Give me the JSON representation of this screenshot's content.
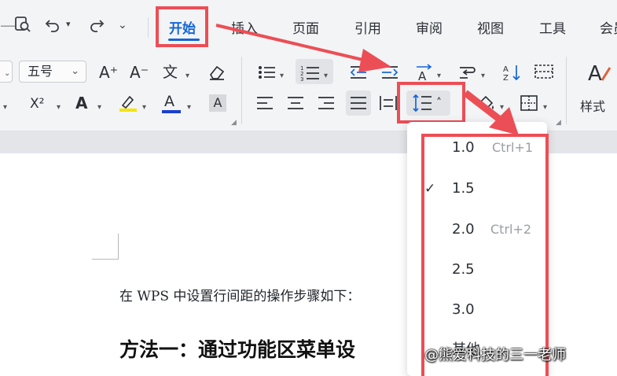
{
  "quick_access": {
    "find_icon": "document-search-icon",
    "undo_icon": "undo-icon",
    "redo_icon": "redo-icon",
    "more_icon": "chevron-down-icon"
  },
  "tabs": [
    {
      "label": "开始",
      "active": true
    },
    {
      "label": "插入"
    },
    {
      "label": "页面"
    },
    {
      "label": "引用"
    },
    {
      "label": "审阅"
    },
    {
      "label": "视图"
    },
    {
      "label": "工具"
    },
    {
      "label": "会员"
    }
  ],
  "ribbon": {
    "font_size_value": "五号",
    "grow_font_label": "A⁺",
    "shrink_font_label": "A⁻",
    "phonetic_label": "文",
    "superscript_label": "X²",
    "text_effect_label": "A",
    "font_color_label": "A",
    "char_shading_label": "A",
    "styles_label": "样式",
    "icons": [
      "bullets-icon",
      "numbering-icon",
      "decrease-indent-icon",
      "increase-indent-icon",
      "text-direction-icon",
      "sort-icon",
      "table-icon",
      "styles-icon",
      "align-left-icon",
      "align-center-icon",
      "align-right-icon",
      "justify-icon",
      "distributed-icon",
      "line-spacing-icon",
      "shading-icon",
      "border-icon",
      "eraser-icon",
      "highlight-icon"
    ]
  },
  "document": {
    "line1": "在 WPS 中设置行间距的操作步骤如下：",
    "heading": "方法一：通过功能区菜单设"
  },
  "line_spacing_menu": {
    "options": [
      {
        "value": "1.0",
        "shortcut": "Ctrl+1",
        "checked": false
      },
      {
        "value": "1.5",
        "shortcut": "",
        "checked": true
      },
      {
        "value": "2.0",
        "shortcut": "Ctrl+2",
        "checked": false
      },
      {
        "value": "2.5",
        "shortcut": "",
        "checked": false
      },
      {
        "value": "3.0",
        "shortcut": "",
        "checked": false
      },
      {
        "value": "其他",
        "shortcut": "",
        "checked": false
      }
    ],
    "check_mark": "✓"
  },
  "watermark": "@熊爱科技的三一老师",
  "colors": {
    "accent": "#1565d8",
    "highlight_box": "#ec4e55",
    "font_color_bar": "#1a3fd1",
    "highlight_bar": "#f5e500"
  }
}
